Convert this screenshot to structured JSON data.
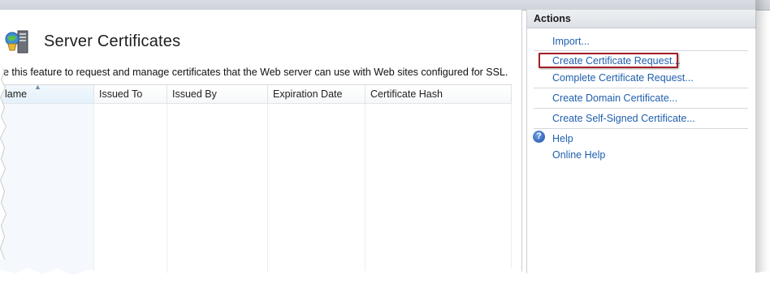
{
  "header": {
    "page_title": "Server Certificates",
    "description": "e this feature to request and manage certificates that the Web server can use with Web sites configured for SSL."
  },
  "grid": {
    "columns": [
      "Name",
      "Issued To",
      "Issued By",
      "Expiration Date",
      "Certificate Hash"
    ],
    "column_first_visible": "lame",
    "sorted_column": "Name",
    "rows": []
  },
  "actions": {
    "heading": "Actions",
    "items": {
      "import": "Import...",
      "create_request": "Create Certificate Request...",
      "complete_request": "Complete Certificate Request...",
      "create_domain": "Create Domain Certificate...",
      "create_self_signed": "Create Self-Signed Certificate...",
      "help": "Help",
      "online_help": "Online Help"
    },
    "highlighted_item": "Create Certificate Request..."
  },
  "icons": {
    "page_icon": "server-certificate-icon",
    "help_icon": "help-icon",
    "sort_icon": "sort-ascending-icon"
  },
  "colors": {
    "link": "#1f5fae",
    "highlight_border": "#a32026",
    "panel_header_bg": "#dde1e6"
  }
}
